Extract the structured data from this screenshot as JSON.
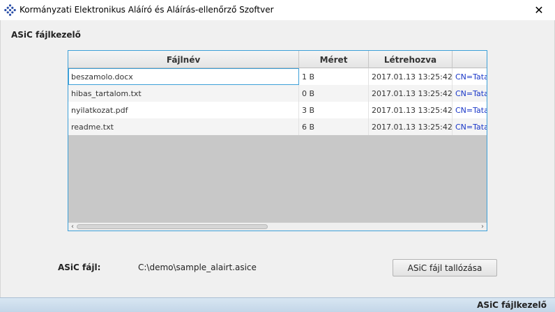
{
  "window": {
    "title": "Kormányzati Elektronikus Aláíró és Aláírás-ellenőrző Szoftver",
    "close_glyph": "✕",
    "app_icon": "diamond-dots-logo-icon"
  },
  "section": {
    "title": "ASiC fájlkezelő"
  },
  "table": {
    "columns": [
      "Fájlnév",
      "Méret",
      "Létrehozva",
      ""
    ],
    "rows": [
      {
        "name": "beszamolo.docx",
        "size": "1 B",
        "created": "2017.01.13 13:25:42",
        "signer": "CN=Tata"
      },
      {
        "name": "hibas_tartalom.txt",
        "size": "0 B",
        "created": "2017.01.13 13:25:42",
        "signer": "CN=Tata"
      },
      {
        "name": "nyilatkozat.pdf",
        "size": "3 B",
        "created": "2017.01.13 13:25:42",
        "signer": "CN=Tata"
      },
      {
        "name": "readme.txt",
        "size": "6 B",
        "created": "2017.01.13 13:25:42",
        "signer": "CN=Tata"
      }
    ],
    "scroll_left_glyph": "‹",
    "scroll_right_glyph": "›"
  },
  "file": {
    "label": "ASiC fájl:",
    "path": "C:\\demo\\sample_alairt.asice",
    "browse_label": "ASiC fájl tallózása"
  },
  "status": {
    "text": "ASiC fájlkezelő"
  },
  "colors": {
    "accent": "#3c9fd8",
    "link": "#1a37c8",
    "logo": "#2b4fa8"
  }
}
